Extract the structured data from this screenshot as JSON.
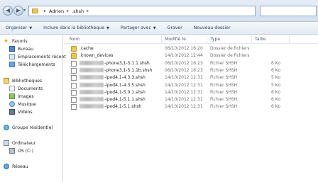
{
  "address": {
    "crumbs": [
      "Adrien",
      ".shsh"
    ]
  },
  "toolbar": {
    "organize": "Organiser",
    "include": "Inclure dans la bibliothèque",
    "share": "Partager avec",
    "burn": "Graver",
    "new_folder": "Nouveau dossier"
  },
  "nav": {
    "favorites": "Favoris",
    "desktop": "Bureau",
    "recent": "Emplacements récent",
    "downloads": "Téléchargements",
    "libraries": "Bibliothèques",
    "documents": "Documents",
    "images": "Images",
    "music": "Musique",
    "videos": "Vidéos",
    "homegroup": "Groupe résidentiel",
    "computer": "Ordinateur",
    "os_drive": "OS (C:)",
    "network": "Réseau"
  },
  "columns": {
    "name": "Nom",
    "modified": "Modifié le",
    "type": "Type",
    "size": "Taille"
  },
  "files": [
    {
      "name": ".cache",
      "date": "06/10/2012 16:20",
      "type": "Dossier de fichiers",
      "size": "",
      "kind": "folder"
    },
    {
      "name": ".known_devices",
      "date": "14/10/2012 12:44",
      "type": "Dossier de fichiers",
      "size": "",
      "kind": "folder"
    },
    {
      "name": "-phone3,1-5.1.1.shsh",
      "date": "06/10/2012 16:23",
      "type": "Fichier SHSH",
      "size": "6 Ko",
      "kind": "file"
    },
    {
      "name": "-phone3,1-5.1.1b.shsh",
      "date": "06/10/2012 16:23",
      "type": "Fichier SHSH",
      "size": "6 Ko",
      "kind": "file"
    },
    {
      "name": "-ipod4,1-4.3.3.shsh",
      "date": "14/10/2012 12:31",
      "type": "Fichier SHSH",
      "size": "5 Ko",
      "kind": "file"
    },
    {
      "name": "-ipod4,1-4.3.5.shsh",
      "date": "14/10/2012 12:31",
      "type": "Fichier SHSH",
      "size": "5 Ko",
      "kind": "file"
    },
    {
      "name": "-ipod4,1-5.0.1.shsh",
      "date": "14/10/2012 12:31",
      "type": "Fichier SHSH",
      "size": "6 Ko",
      "kind": "file"
    },
    {
      "name": "-ipod4,1-5.1.1.shsh",
      "date": "14/10/2012 12:31",
      "type": "Fichier SHSH",
      "size": "6 Ko",
      "kind": "file"
    },
    {
      "name": "-ipod4,1-5.1.shsh",
      "date": "14/10/2012 12:31",
      "type": "Fichier SHSH",
      "size": "6 Ko",
      "kind": "file"
    }
  ]
}
